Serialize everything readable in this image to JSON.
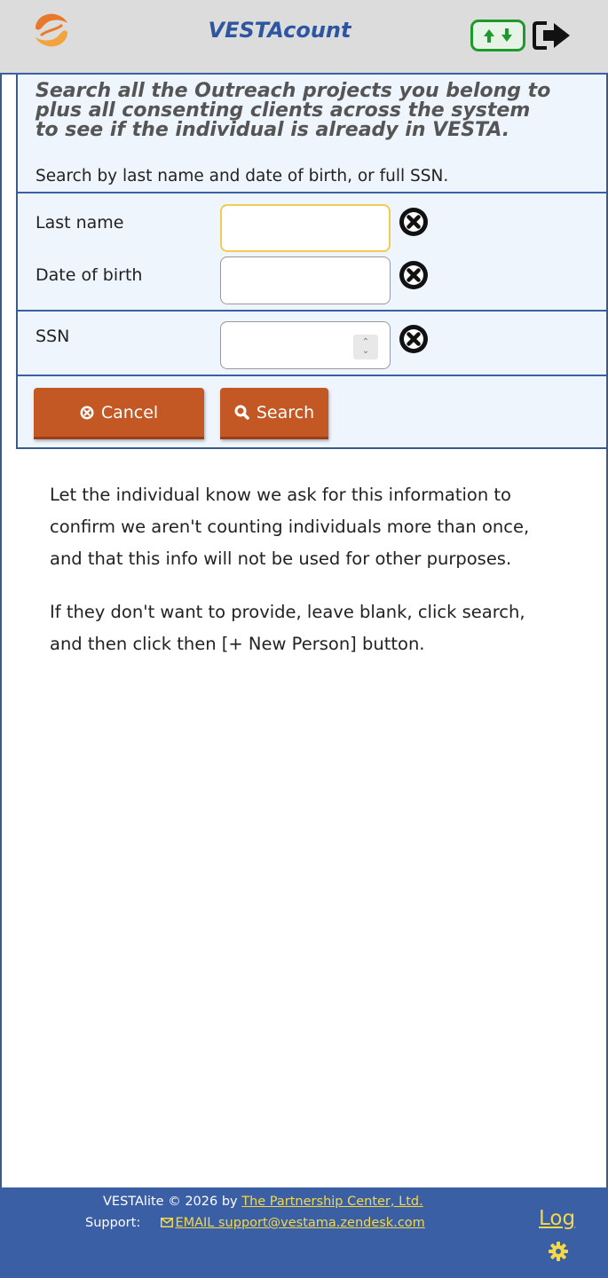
{
  "app": {
    "title": "VESTAcount"
  },
  "panel": {
    "intro_line1": "Search all the Outreach projects you belong to",
    "intro_line2": "plus all consenting clients across the system",
    "intro_line3": "to see if the individual is already in VESTA.",
    "intro_sub": "Search by last name and date of birth, or full SSN."
  },
  "form": {
    "last_name_label": "Last name",
    "last_name_value": "",
    "dob_label": "Date of birth",
    "dob_value": "",
    "ssn_label": "SSN",
    "ssn_value": ""
  },
  "buttons": {
    "cancel_label": "Cancel",
    "search_label": "Search"
  },
  "notes": {
    "line1": "Let the individual know we ask for this information to",
    "line2": "confirm we aren't counting individuals more than once,",
    "line3": "and that this info will not be used for other purposes.",
    "line4": "If they don't want to provide, leave blank, click search,",
    "line5": "and then click then [+ New Person] button."
  },
  "footer": {
    "copyright_prefix": "VESTAlite © 2026 by ",
    "copyright_link": "The Partnership Center, Ltd.",
    "support_label": "Support:",
    "support_email": "EMAIL support@vestama.zendesk.com",
    "log_label": "Log"
  },
  "colors": {
    "header_bg": "#dcdcdc",
    "panel_bg": "#eef5fd",
    "accent_blue": "#3b5fa5",
    "button_orange": "#c45824",
    "sync_green": "#1e9a2c",
    "link_yellow": "#f3d84a"
  },
  "icons": {
    "logo": "vesta-logo-icon",
    "sync": "sync-arrows-icon",
    "exit": "exit-arrow-icon",
    "clear": "clear-circle-x-icon",
    "cancel": "cancel-circle-icon",
    "search": "search-magnifier-icon",
    "email": "envelope-icon",
    "gear": "gear-icon"
  }
}
